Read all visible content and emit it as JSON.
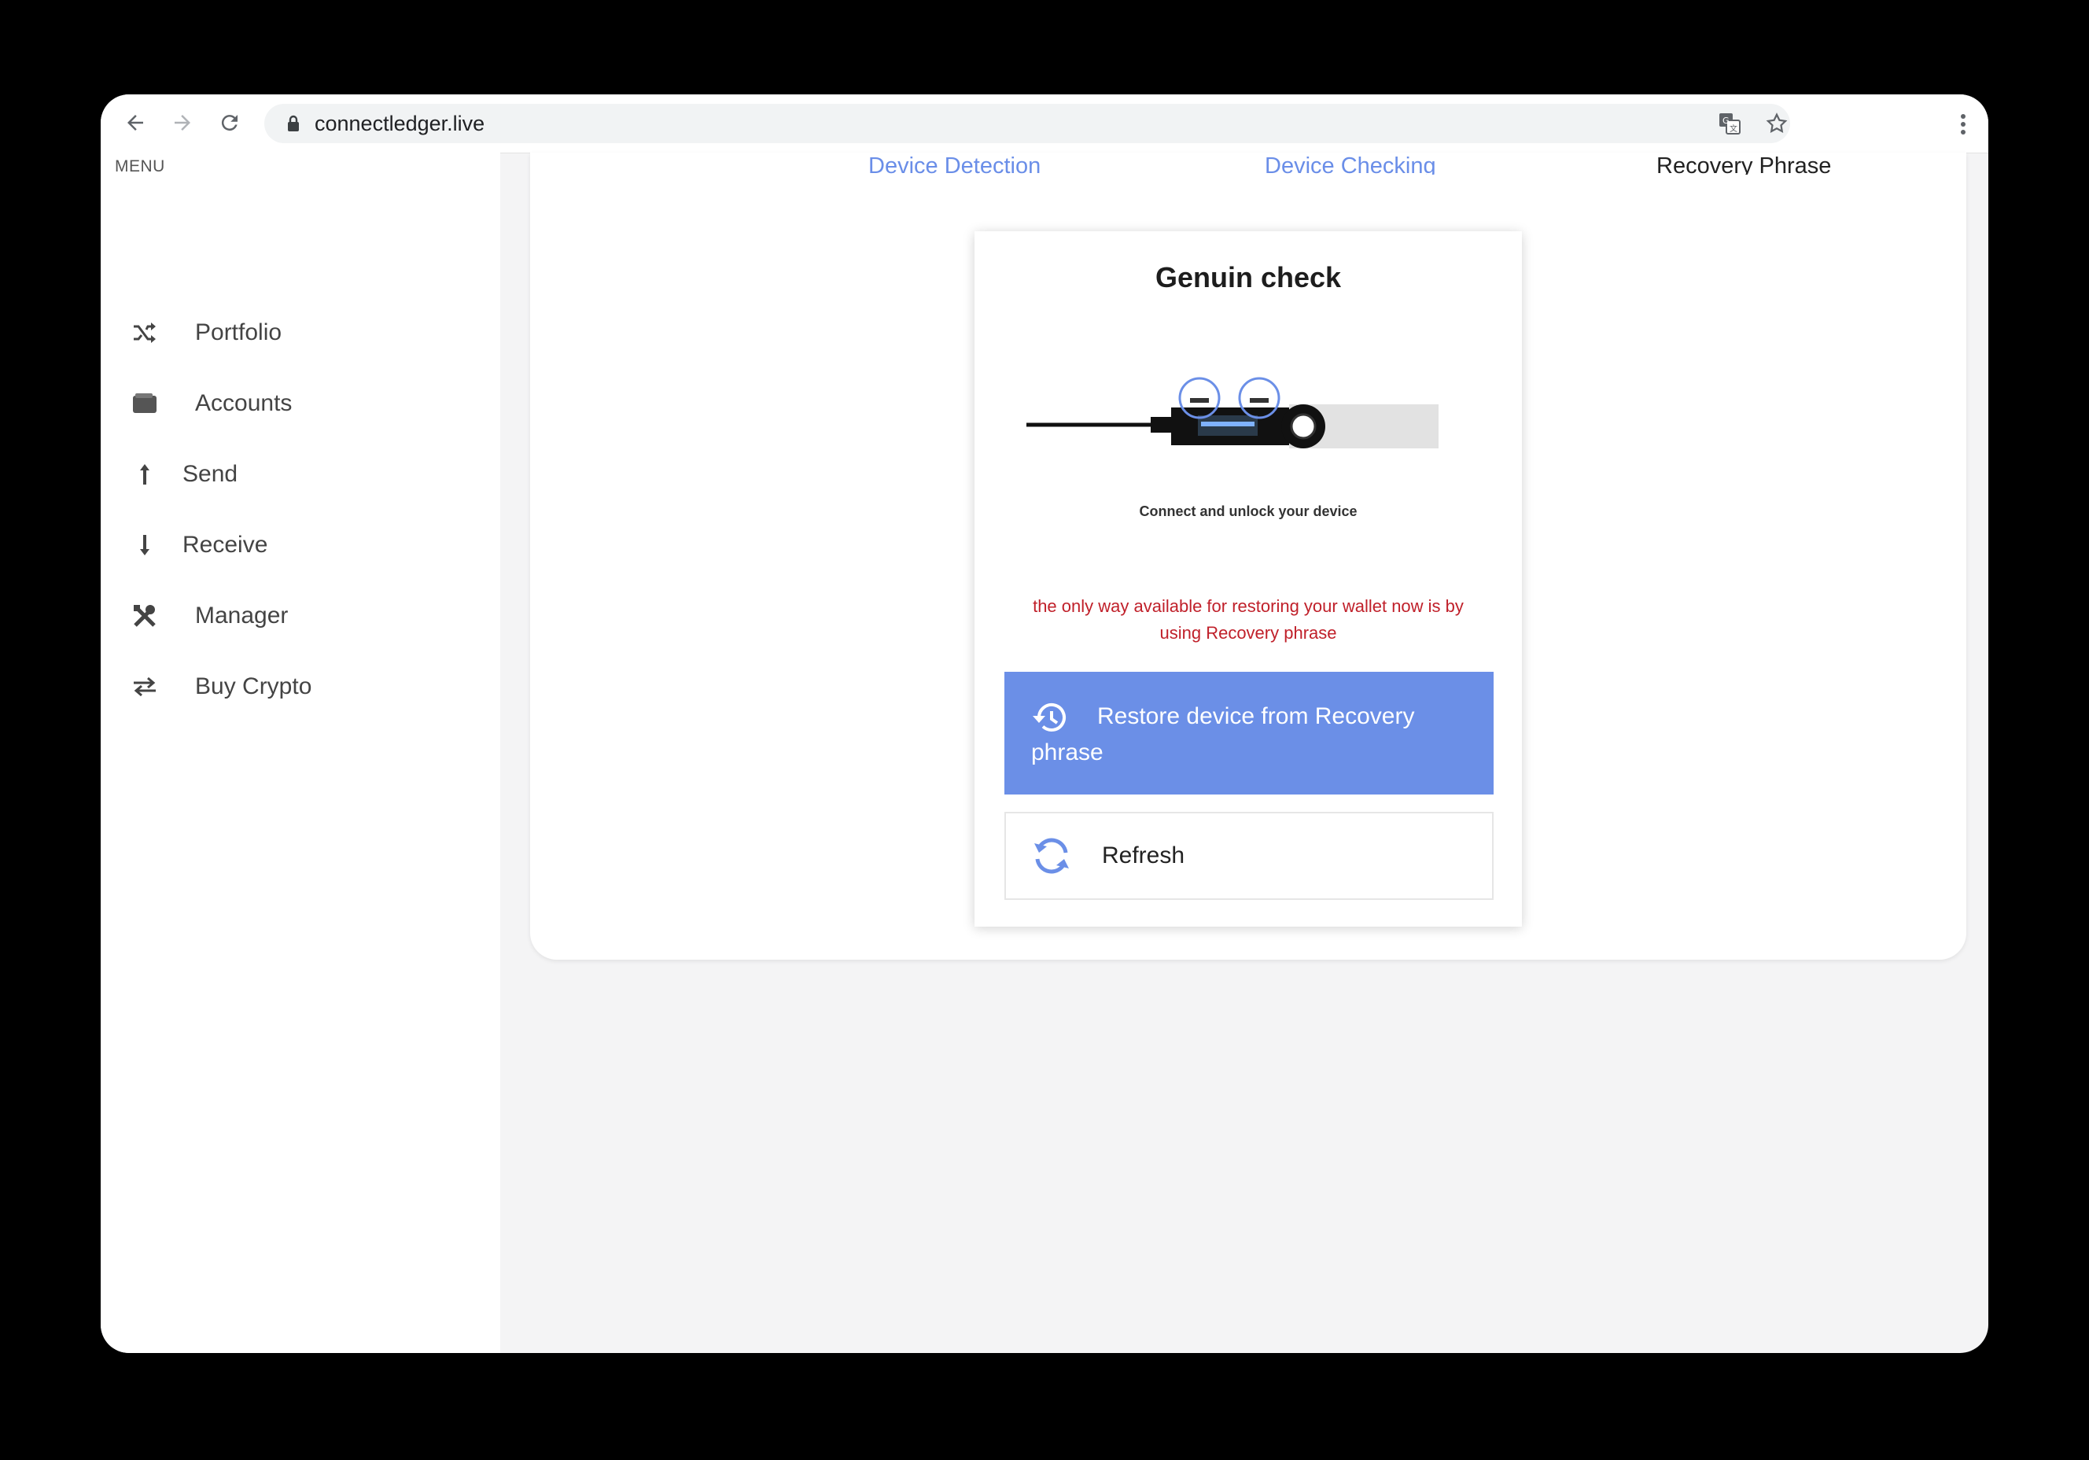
{
  "browser": {
    "url": "connectledger.live",
    "icons": [
      "back-arrow-icon",
      "forward-arrow-icon",
      "reload-icon",
      "lock-icon",
      "translate-icon",
      "star-icon",
      "more-vertical-icon"
    ]
  },
  "sidebar": {
    "heading": "MENU",
    "items": [
      {
        "label": "Portfolio",
        "icon": "shuffle-icon"
      },
      {
        "label": "Accounts",
        "icon": "wallet-icon"
      },
      {
        "label": "Send",
        "icon": "arrow-up-icon"
      },
      {
        "label": "Receive",
        "icon": "arrow-down-icon"
      },
      {
        "label": "Manager",
        "icon": "tools-icon"
      },
      {
        "label": "Buy Crypto",
        "icon": "swap-icon"
      }
    ]
  },
  "steps": [
    {
      "label": "Device Detection",
      "state": "done"
    },
    {
      "label": "Device Checking",
      "state": "done"
    },
    {
      "label": "Recovery Phrase",
      "state": "active"
    }
  ],
  "card": {
    "title": "Genuin check",
    "caption": "Connect and unlock your device",
    "warning": "the only way available for restoring your wallet now is by using Recovery phrase",
    "restore_button": "Restore device from Recovery phrase",
    "refresh_button": "Refresh"
  },
  "colors": {
    "accent": "#6b8fe7",
    "link": "#6a8ee8",
    "warning": "#c0202a",
    "background": "#f4f4f5"
  }
}
